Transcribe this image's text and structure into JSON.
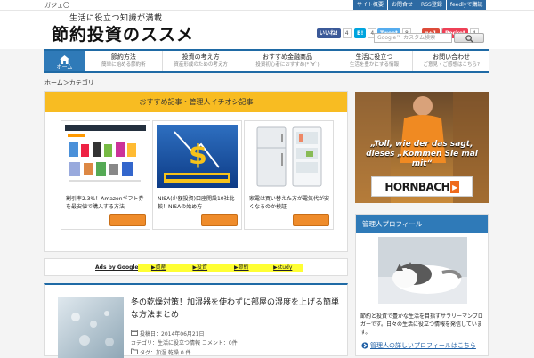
{
  "topbar": {
    "label": "ガジェ〇",
    "links": [
      "サイト概要",
      "お問合せ",
      "RSS登録",
      "feedlyで購読"
    ]
  },
  "header": {
    "tagline": "生活に役立つ知識が満載",
    "logo": "節約投資のススメ",
    "social": [
      {
        "label": "いいね!",
        "count": "4",
        "color": "#3b5998"
      },
      {
        "label": "B!",
        "count": "4",
        "color": "#00a4de"
      },
      {
        "label": "Tweet",
        "count": "8",
        "color": "#55acee"
      },
      {
        "label": "g+1",
        "count": "1",
        "color": "#dd4b39"
      },
      {
        "label": "Pocket",
        "count": "4",
        "color": "#ee4056"
      }
    ],
    "search_placeholder": "Google™ カスタム検索"
  },
  "nav": {
    "home_label": "ホーム",
    "items": [
      {
        "title": "節約方法",
        "sub": "簡単に始める節約術"
      },
      {
        "title": "投資の考え方",
        "sub": "資産形成のための考え方"
      },
      {
        "title": "おすすめ金融商品",
        "sub": "投資初心者におすすめ(*´∀`)"
      },
      {
        "title": "生活に役立つ",
        "sub": "生活を豊かにする情報"
      },
      {
        "title": "お問い合わせ",
        "sub": "ご意見・ご感想はこちら?"
      }
    ]
  },
  "breadcrumb": "ホーム＞カテゴリ",
  "recommend": {
    "heading": "おすすめ記事・管理人イチオシ記事",
    "cards": [
      {
        "title": "割引率2.3%！Amazonギフト券を最安値で購入する方法"
      },
      {
        "title": "NISA(少額投資)口座開設10社比較！NISAの始め方"
      },
      {
        "title": "家電は買い替えた方が電気代が安くなるのか検証"
      }
    ]
  },
  "ads": {
    "label": "Ads by Google",
    "items": [
      "▶資産",
      "▶投資",
      "▶節約",
      "▶study"
    ]
  },
  "post": {
    "title": "冬の乾燥対策！加湿器を使わずに部屋の湿度を上げる簡単な方法まとめ",
    "date": "投稿日：2014年06月21日",
    "category": "カテゴリ：生活に役立つ情報  コメント：0件",
    "tags": "タグ：加湿 乾燥 0 件"
  },
  "sidebar_ad": {
    "text": "„Toll, wie der das sagt, dieses „Kommen Sie mal mit“",
    "logo": "HORNBACH"
  },
  "profile": {
    "heading": "管理人プロフィール",
    "desc": "節約と投資で豊かな生活を目指すサラリーマンブロガーです。日々の生活に役立つ情報を発信しています。",
    "link": "管理人の詳しいプロフィールはこちら"
  }
}
